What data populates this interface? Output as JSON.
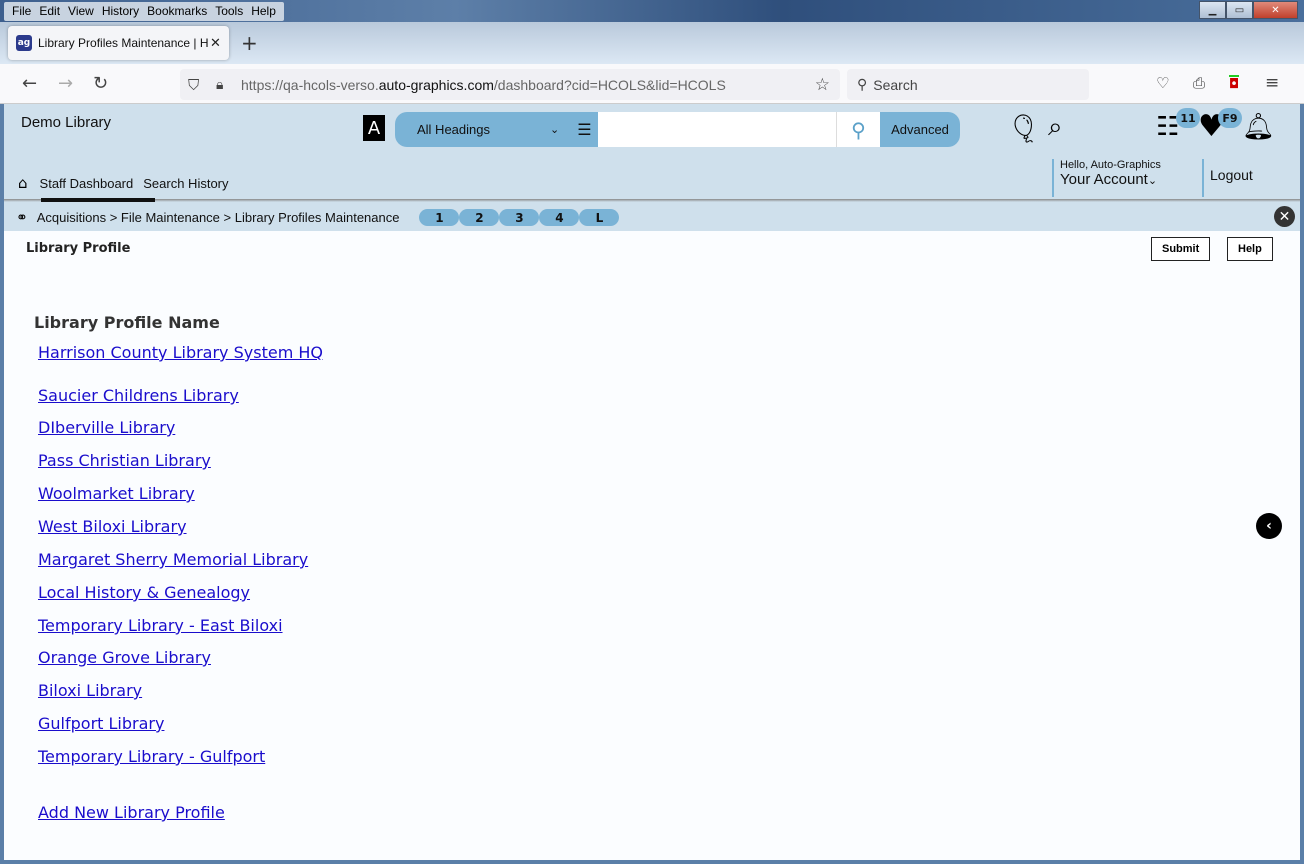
{
  "browser": {
    "menu": [
      "File",
      "Edit",
      "View",
      "History",
      "Bookmarks",
      "Tools",
      "Help"
    ],
    "tab_title": "Library Profiles Maintenance | H",
    "url_prefix": "https://qa-hcols-verso.",
    "url_domain": "auto-graphics.com",
    "url_suffix": "/dashboard?cid=HCOLS&lid=HCOLS",
    "search_placeholder": "Search"
  },
  "header": {
    "brand": "Demo Library",
    "scope_selected": "All Headings",
    "search_value": "",
    "advanced_label": "Advanced",
    "list_badge": "11",
    "favorites_badge": "F9",
    "hello": "Hello, Auto-Graphics",
    "account": "Your Account",
    "logout": "Logout"
  },
  "nav": {
    "items": [
      "Staff Dashboard",
      "Search History"
    ]
  },
  "breadcrumb": {
    "path": "Acquisitions > File Maintenance > Library Profiles Maintenance",
    "pills": [
      "1",
      "2",
      "3",
      "4",
      "L"
    ]
  },
  "page": {
    "title": "Library Profile",
    "submit_label": "Submit",
    "help_label": "Help",
    "column_header": "Library Profile Name",
    "profiles": [
      "Harrison County Library System HQ",
      "Saucier Childrens Library",
      "DIberville Library",
      "Pass Christian Library",
      "Woolmarket Library",
      "West Biloxi Library",
      "Margaret Sherry Memorial Library",
      "Local History & Genealogy",
      "Temporary Library - East Biloxi",
      "Orange Grove Library",
      "Biloxi Library",
      "Gulfport Library",
      "Temporary Library - Gulfport"
    ],
    "add_new_label": "Add New Library Profile"
  }
}
